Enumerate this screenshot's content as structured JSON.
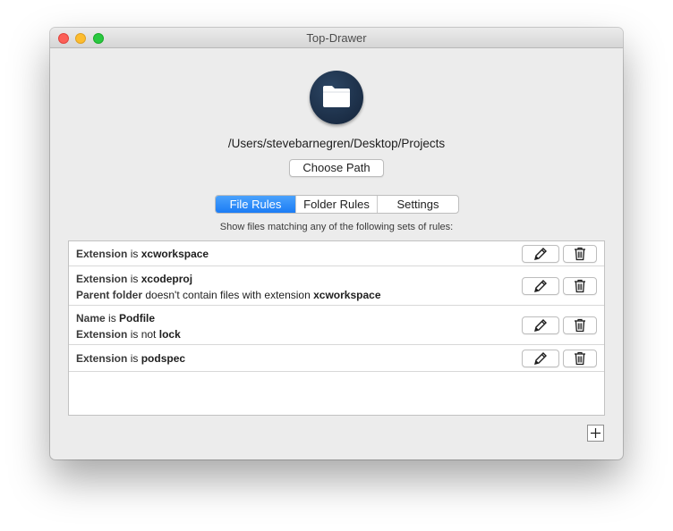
{
  "window": {
    "title": "Top-Drawer"
  },
  "header": {
    "icon": "folder-icon",
    "path": "/Users/stevebarnegren/Desktop/Projects",
    "choose_label": "Choose Path"
  },
  "tabs": [
    {
      "label": "File Rules",
      "selected": true
    },
    {
      "label": "Folder Rules",
      "selected": false
    },
    {
      "label": "Settings",
      "selected": false
    }
  ],
  "hint": "Show files matching any of the following sets of rules:",
  "rules": [
    {
      "lines": [
        {
          "field": "Extension",
          "op": "is",
          "value": "xcworkspace"
        }
      ]
    },
    {
      "lines": [
        {
          "field": "Extension",
          "op": "is",
          "value": "xcodeproj"
        },
        {
          "field": "Parent folder",
          "op": "doesn't contain files with extension",
          "value": "xcworkspace"
        }
      ]
    },
    {
      "lines": [
        {
          "field": "Name",
          "op": "is",
          "value": "Podfile"
        },
        {
          "field": "Extension",
          "op": "is not",
          "value": "lock"
        }
      ]
    },
    {
      "lines": [
        {
          "field": "Extension",
          "op": "is",
          "value": "podspec"
        }
      ]
    }
  ],
  "icons": {
    "edit": "pencil-icon",
    "delete": "trash-icon",
    "add": "plus-icon"
  },
  "colors": {
    "accent": "#1b7cf5",
    "folder_circle": "#1b2d47"
  }
}
